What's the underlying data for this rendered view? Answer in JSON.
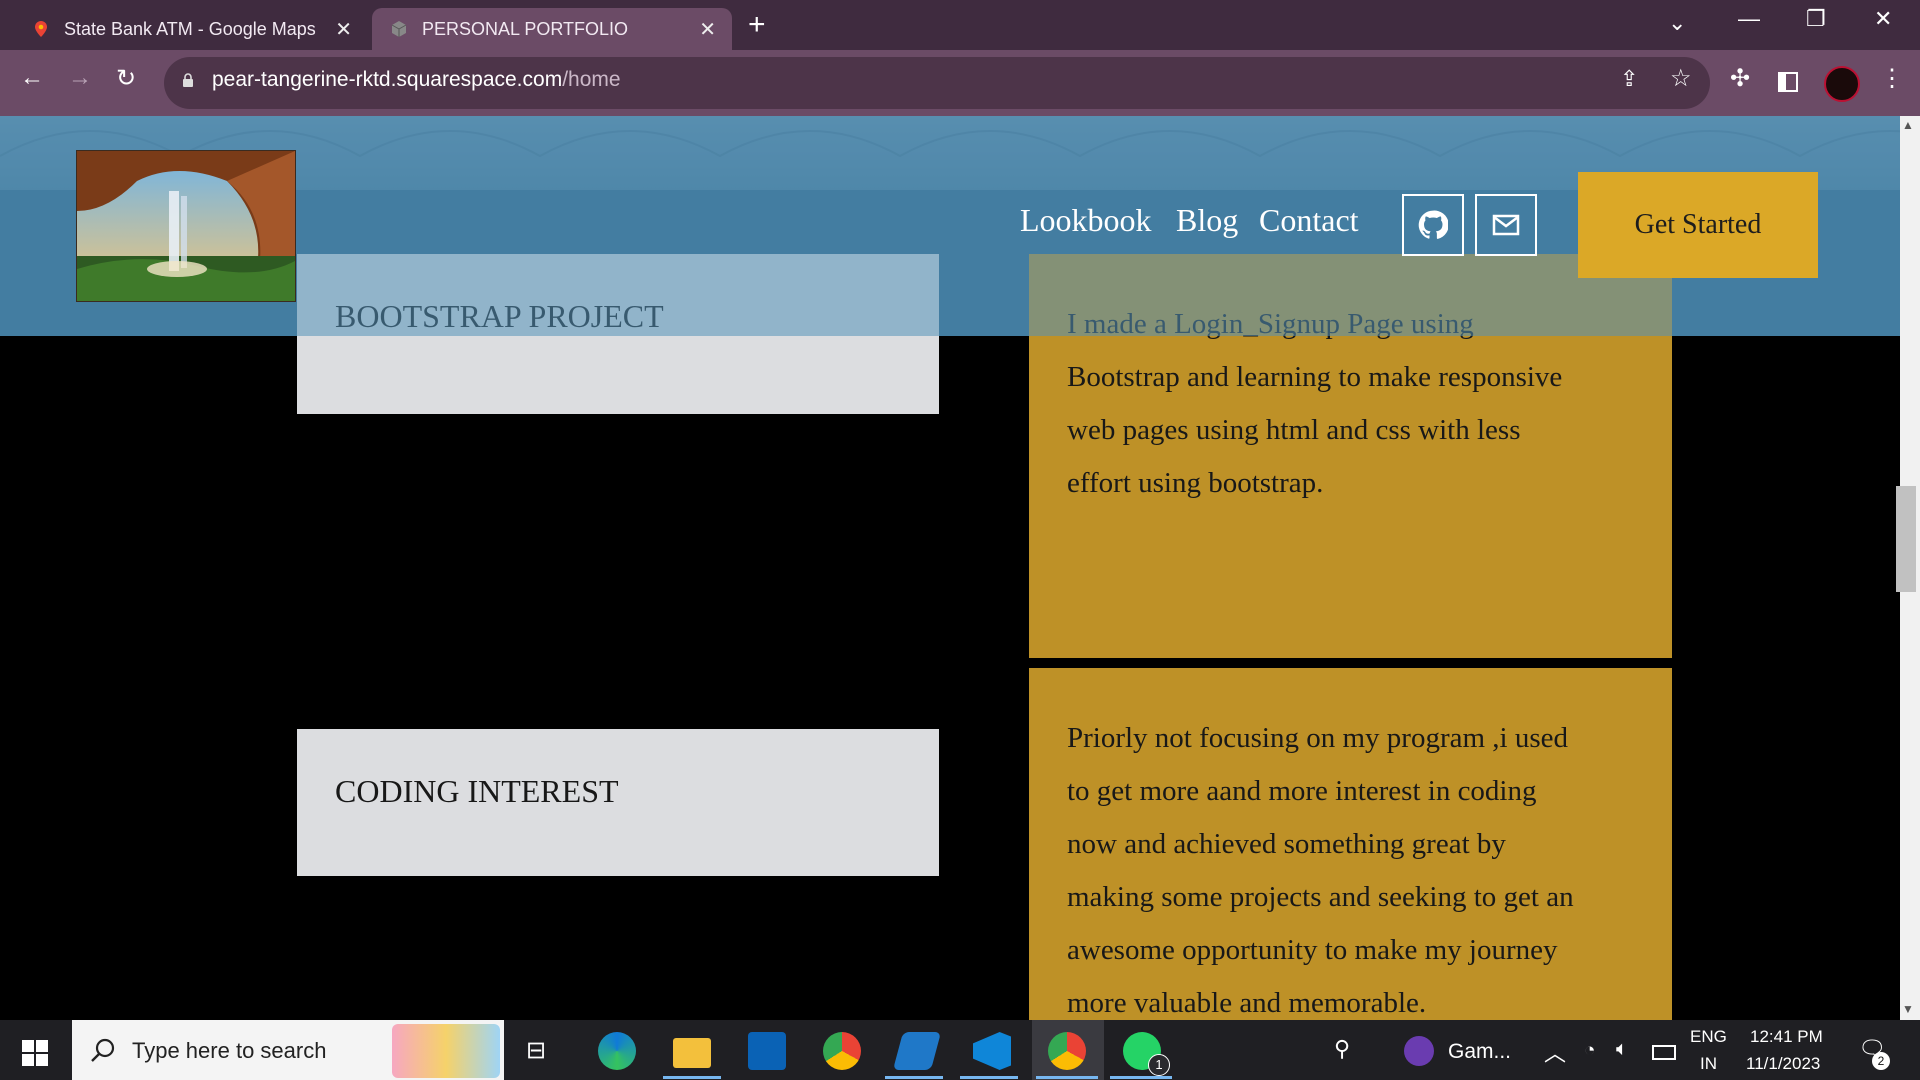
{
  "browser": {
    "tabs": [
      {
        "title": "State Bank ATM - Google Maps",
        "active": false
      },
      {
        "title": "PERSONAL PORTFOLIO",
        "active": true
      }
    ],
    "url_domain": "pear-tangerine-rktd.squarespace.com",
    "url_path": "/home"
  },
  "site": {
    "nav": [
      "Lookbook",
      "Blog",
      "Contact"
    ],
    "cta": "Get Started",
    "sections": [
      {
        "title": "BOOTSTRAP PROJECT",
        "text": [
          "I made a Login_Signup Page using",
          "Bootstrap and learning to make responsive",
          "web pages using html and css with less",
          "effort using bootstrap."
        ]
      },
      {
        "title": "CODING INTEREST",
        "text": [
          "Priorly not focusing on my program ,i used",
          "to get more aand more interest in coding",
          "now and achieved something great by",
          "making some projects and seeking to get  an",
          "awesome opportunity to make my journey",
          "more valuable and memorable."
        ]
      }
    ]
  },
  "taskbar": {
    "search_placeholder": "Type here to search",
    "game_label": "Gam...",
    "lang": "ENG",
    "region": "IN",
    "time": "12:41 PM",
    "date": "11/1/2023",
    "notifications": "2",
    "whatsapp_badge": "1"
  },
  "colors": {
    "accent_gold": "#be9127",
    "cta_gold": "#dba827",
    "header_blue": "#2f6485"
  }
}
